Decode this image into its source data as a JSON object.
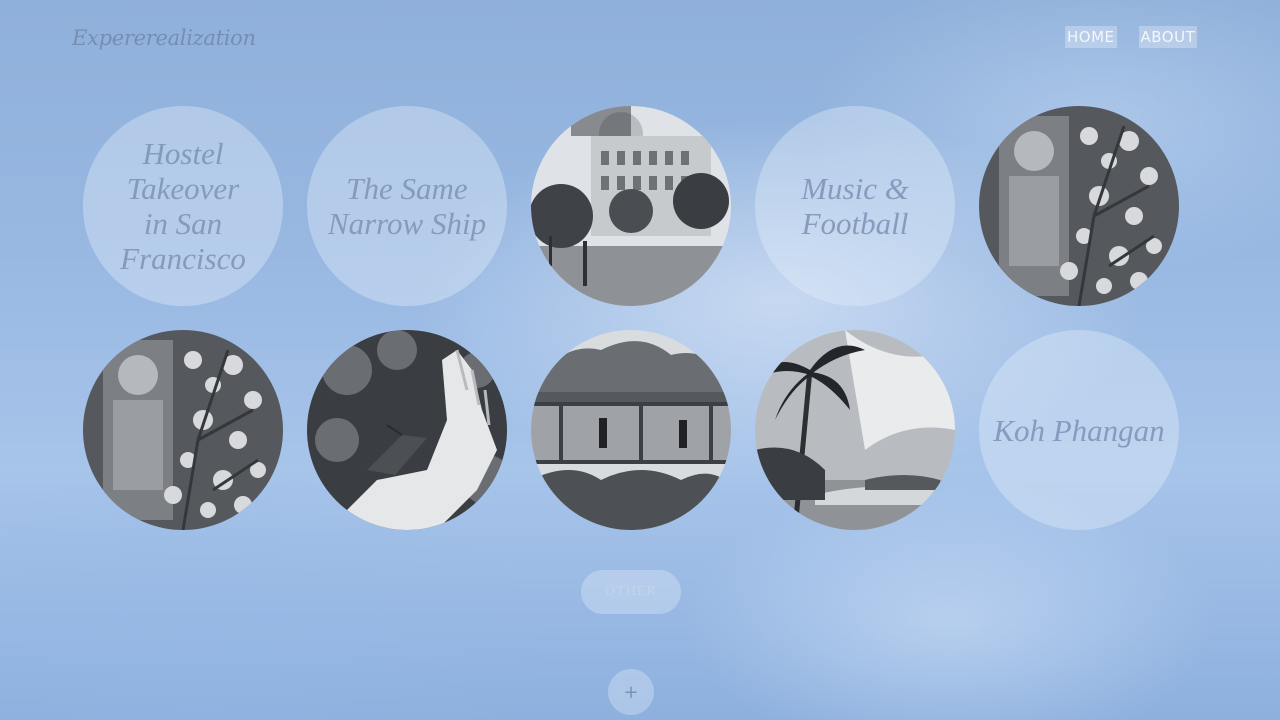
{
  "header": {
    "logo": "Expererealization",
    "nav": [
      {
        "label": "HOME"
      },
      {
        "label": "ABOUT"
      }
    ]
  },
  "posts": [
    {
      "type": "text",
      "title": "Hostel Takeover\nin San\nFrancisco"
    },
    {
      "type": "text",
      "title": "The Same\nNarrow Ship"
    },
    {
      "type": "photo",
      "icon": "street-building-photo"
    },
    {
      "type": "text",
      "title": "Music &\nFootball"
    },
    {
      "type": "photo",
      "icon": "temple-statue-photo"
    },
    {
      "type": "photo",
      "icon": "temple-statue-photo"
    },
    {
      "type": "photo",
      "icon": "butterfly-hand-photo"
    },
    {
      "type": "photo",
      "icon": "footbridge-photo"
    },
    {
      "type": "photo",
      "icon": "palm-beach-photo"
    },
    {
      "type": "text",
      "title": "Koh Phangan"
    }
  ],
  "footer": {
    "other_label": "OTHER",
    "plus_label": "+"
  }
}
